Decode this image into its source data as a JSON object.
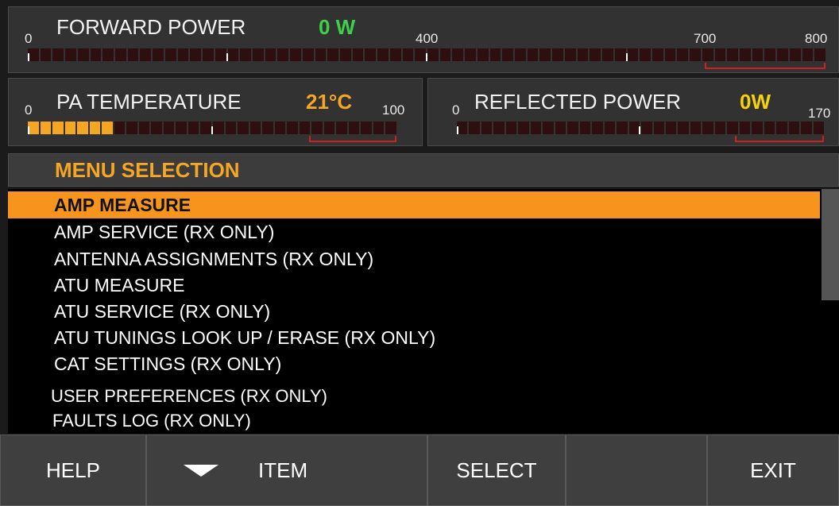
{
  "forward_power": {
    "title": "FORWARD POWER",
    "value": "0 W",
    "value_color": "#3dd14a",
    "ticks": [
      "0",
      "400",
      "700",
      "800"
    ],
    "level": 0
  },
  "pa_temperature": {
    "title": "PA TEMPERATURE",
    "value": "21°C",
    "value_color": "#f5a623",
    "ticks": [
      "0",
      "100"
    ],
    "level": 0.21
  },
  "reflected_power": {
    "title": "REFLECTED POWER",
    "value": "0W",
    "value_color": "#f5d20a",
    "ticks": [
      "0",
      "170"
    ],
    "level": 0
  },
  "menu": {
    "header": "MENU SELECTION",
    "items": [
      "AMP MEASURE",
      "AMP SERVICE (RX ONLY)",
      "ANTENNA ASSIGNMENTS (RX ONLY)",
      "ATU MEASURE",
      "ATU SERVICE (RX ONLY)",
      "ATU TUNINGS LOOK UP / ERASE (RX ONLY)",
      "CAT SETTINGS (RX ONLY)",
      "USER PREFERENCES (RX ONLY)",
      "FAULTS LOG (RX ONLY)"
    ],
    "selected_index": 0
  },
  "buttons": {
    "help": "HELP",
    "item": "ITEM",
    "select": "SELECT",
    "blank": "",
    "exit": "EXIT"
  },
  "colors": {
    "accent": "#f7941d",
    "meter_on": "#f5a623",
    "alarm_zone": "#d11f1f"
  }
}
